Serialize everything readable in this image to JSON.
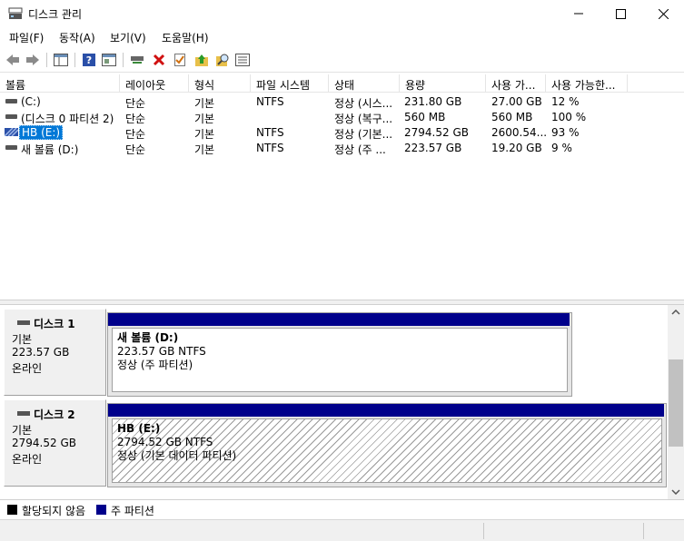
{
  "window": {
    "title": "디스크 관리"
  },
  "menu": {
    "file": "파일(F)",
    "action": "동작(A)",
    "view": "보기(V)",
    "help": "도움말(H)"
  },
  "toolbar": {
    "icons": [
      "back-arrow-icon",
      "forward-arrow-icon",
      "console-tree-icon",
      "help-book-icon",
      "properties-panel-icon",
      "connect-disk-icon",
      "delete-x-icon",
      "check-properties-icon",
      "up-folder-icon",
      "search-find-icon",
      "list-view-icon"
    ]
  },
  "columns": [
    "볼륨",
    "레이아웃",
    "형식",
    "파일 시스템",
    "상태",
    "용량",
    "사용 가...",
    "사용 가능한..."
  ],
  "volumes": [
    {
      "name": "(C:)",
      "layout": "단순",
      "type": "기본",
      "fs": "NTFS",
      "status": "정상 (시스...",
      "capacity": "231.80 GB",
      "free": "27.00 GB",
      "pct": "12 %"
    },
    {
      "name": "(디스크 0 파티션 2)",
      "layout": "단순",
      "type": "기본",
      "fs": "",
      "status": "정상 (복구...",
      "capacity": "560 MB",
      "free": "560 MB",
      "pct": "100 %"
    },
    {
      "name": "HB (E:)",
      "layout": "단순",
      "type": "기본",
      "fs": "NTFS",
      "status": "정상 (기본...",
      "capacity": "2794.52 GB",
      "free": "2600.54...",
      "pct": "93 %"
    },
    {
      "name": "새 볼륨 (D:)",
      "layout": "단순",
      "type": "기본",
      "fs": "NTFS",
      "status": "정상 (주 ...",
      "capacity": "223.57 GB",
      "free": "19.20 GB",
      "pct": "9 %"
    }
  ],
  "disks": [
    {
      "name": "디스크 1",
      "type": "기본",
      "size": "223.57 GB",
      "state": "온라인",
      "partition": {
        "label": "새 볼륨  (D:)",
        "size": "223.57 GB NTFS",
        "status": "정상 (주 파티션)"
      }
    },
    {
      "name": "디스크 2",
      "type": "기본",
      "size": "2794.52 GB",
      "state": "온라인",
      "partition": {
        "label": "HB  (E:)",
        "size": "2794.52 GB NTFS",
        "status": "정상 (기본 데이터 파티션)"
      }
    }
  ],
  "legend": [
    {
      "label": "할당되지 않음",
      "color": "#000000"
    },
    {
      "label": "주 파티션",
      "color": "#00008b"
    }
  ],
  "colors": {
    "primary_partition": "#00008b",
    "selection": "#0078d7"
  }
}
